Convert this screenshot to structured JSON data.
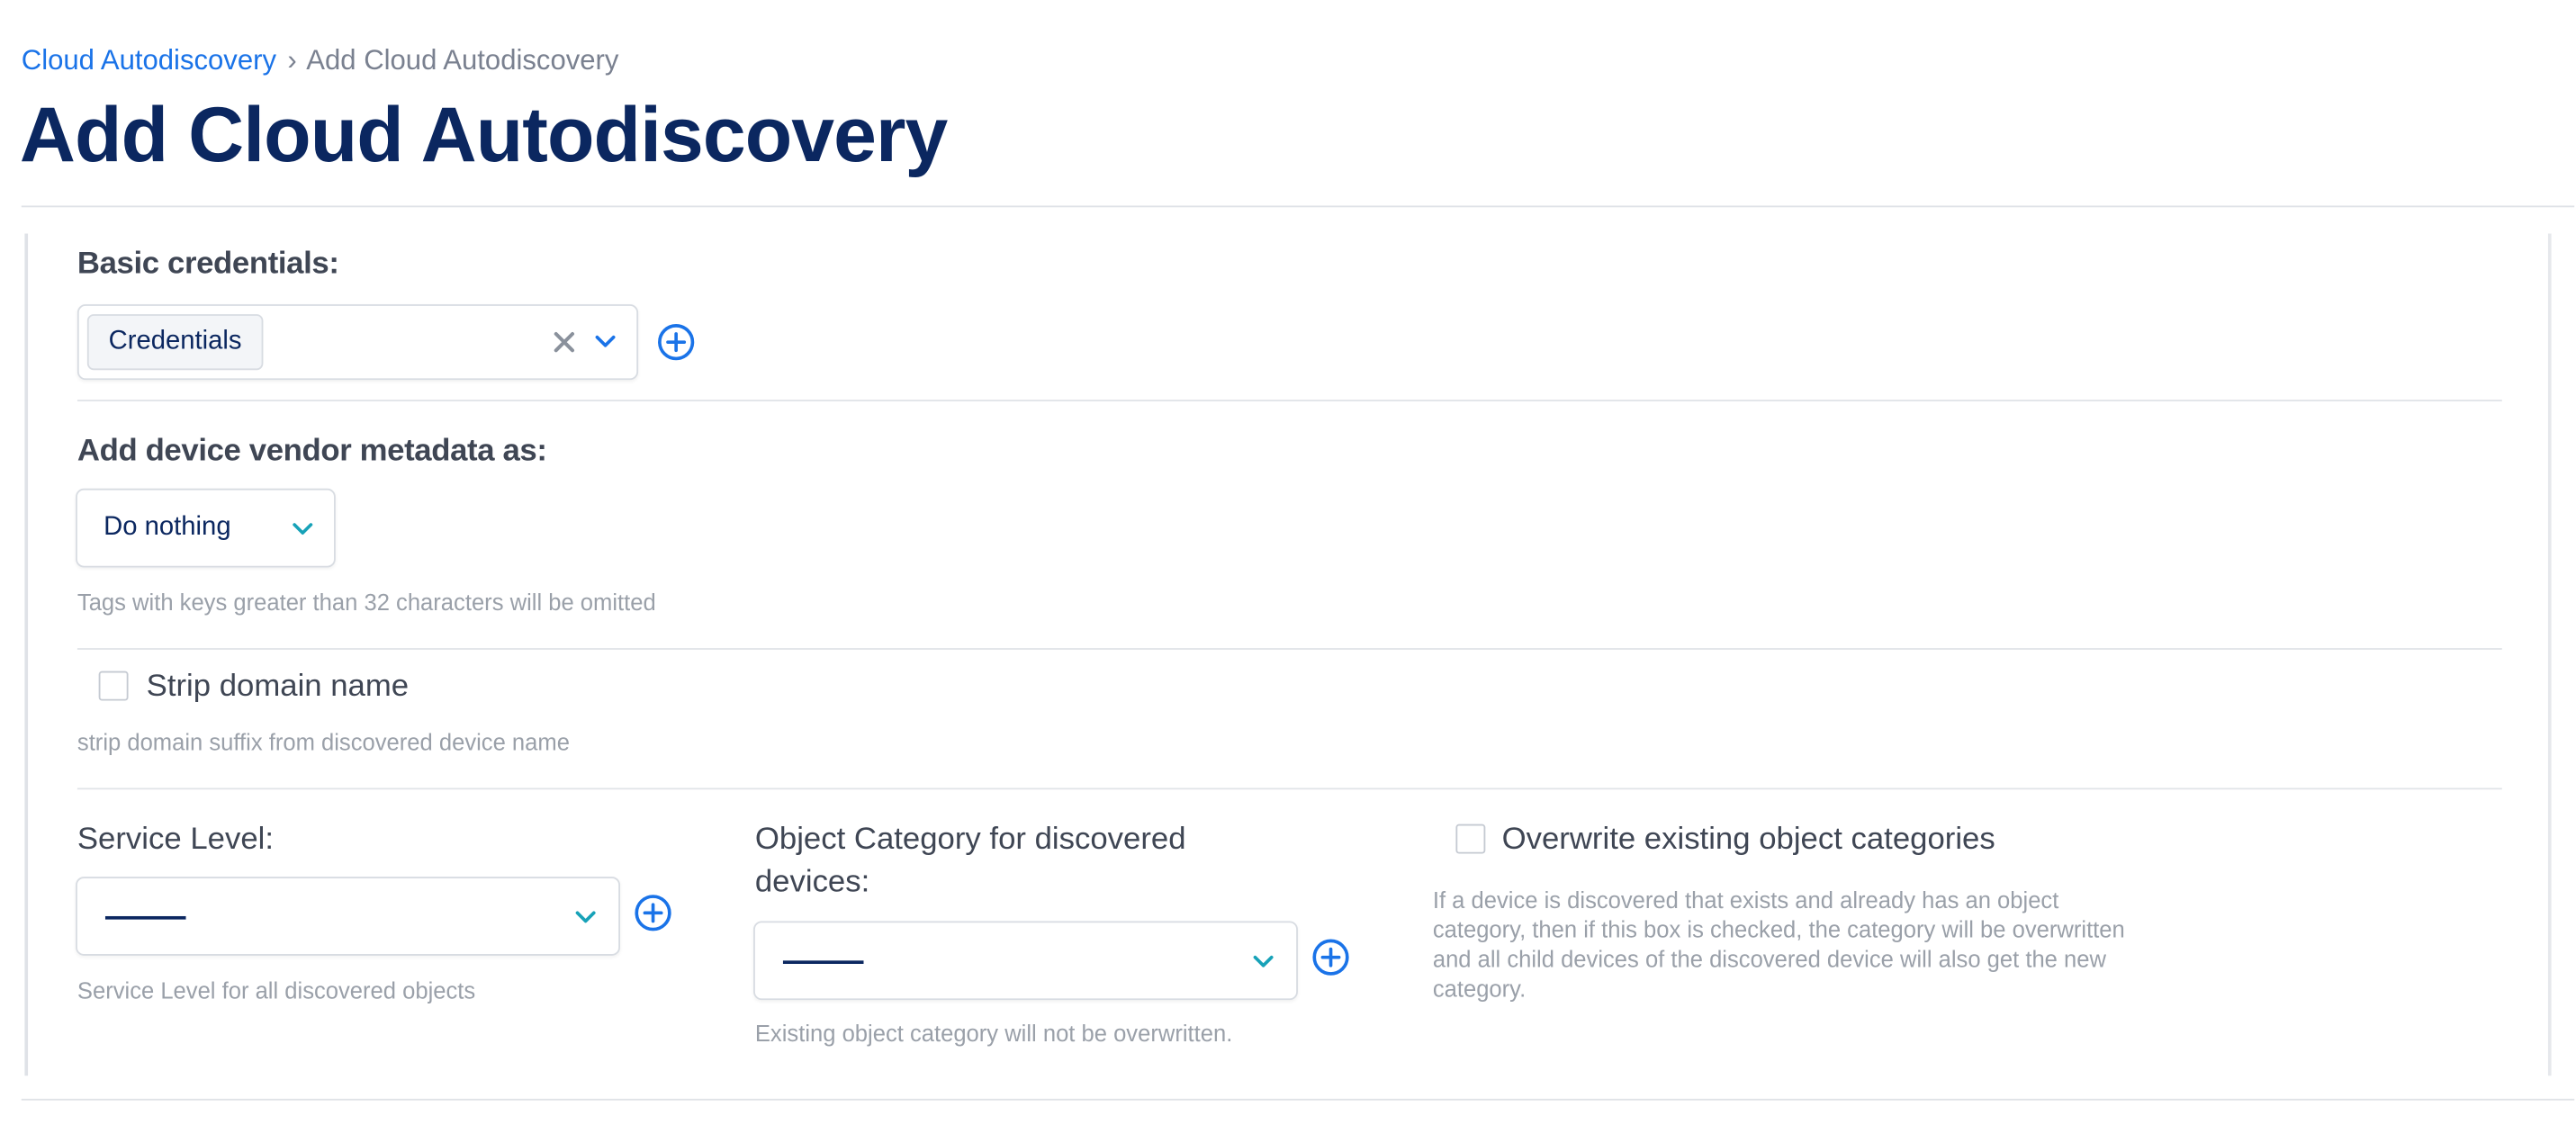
{
  "breadcrumb": {
    "parent": "Cloud Autodiscovery",
    "separator": "›",
    "current": "Add Cloud Autodiscovery"
  },
  "page_title": "Add Cloud Autodiscovery",
  "basic_credentials": {
    "label": "Basic credentials:",
    "selected_chip": "Credentials"
  },
  "vendor_metadata": {
    "label": "Add device vendor metadata as:",
    "selected_value": "Do nothing",
    "hint": "Tags with keys greater than 32 characters will be omitted"
  },
  "strip_domain": {
    "label": "Strip domain name",
    "checked": false,
    "hint": "strip domain suffix from discovered device name"
  },
  "service_level": {
    "label": "Service Level:",
    "selected_value": "",
    "hint": "Service Level for all discovered objects"
  },
  "object_category": {
    "label_line1": "Object Category for discovered",
    "label_line2": "devices:",
    "selected_value": "",
    "hint": "Existing object category will not be overwritten."
  },
  "overwrite_categories": {
    "label": "Overwrite existing object categories",
    "checked": false,
    "hint_line1": "If a device is discovered that exists and already has an object",
    "hint_line2": "category, then if this box is checked, the category will be overwritten",
    "hint_line3": "and all child devices of the discovered device will also get the new",
    "hint_line4": "category."
  },
  "icons": {
    "clear": "close-icon",
    "dropdown": "chevron-down-icon",
    "add": "plus-circle-icon"
  },
  "colors": {
    "link": "#1a73e8",
    "title": "#0b2760",
    "chevron_teal": "#17a2b8",
    "add_blue": "#1a73e8",
    "muted_text": "#9aa0a9",
    "clear_gray": "#8a919c"
  }
}
